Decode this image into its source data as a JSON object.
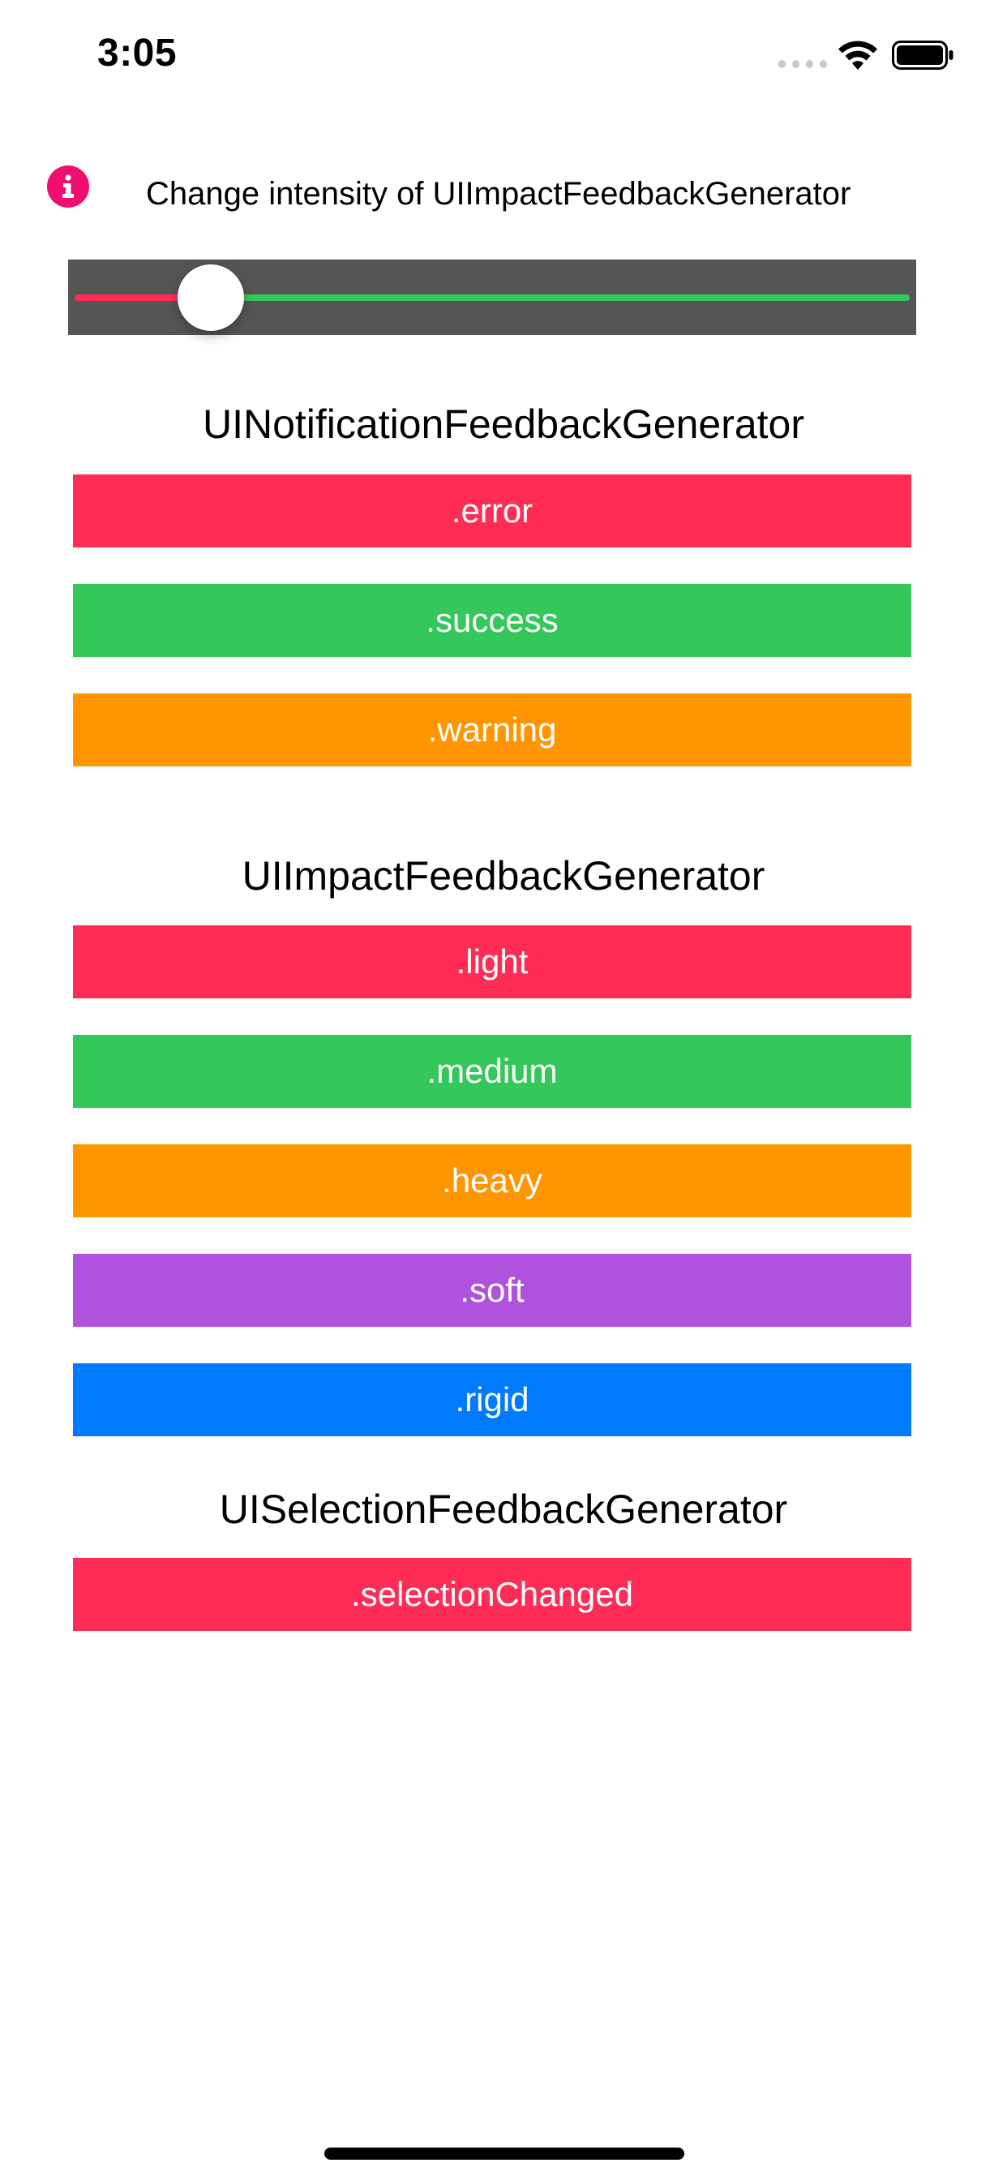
{
  "status_bar": {
    "time": "3:05",
    "signal_icon": "cellular-signal-dots-icon",
    "wifi_icon": "wifi-icon",
    "battery_icon": "battery-full-icon"
  },
  "intensity": {
    "info_icon": "info-icon",
    "label": "Change intensity of UIImpactFeedbackGenerator",
    "slider_value": 0.14
  },
  "sections": {
    "notification": {
      "title": "UINotificationFeedbackGenerator",
      "buttons": [
        {
          "label": ".error",
          "color": "#ff2d55"
        },
        {
          "label": ".success",
          "color": "#34c759"
        },
        {
          "label": ".warning",
          "color": "#ff9500"
        }
      ]
    },
    "impact": {
      "title": "UIImpactFeedbackGenerator",
      "buttons": [
        {
          "label": ".light",
          "color": "#ff2d55"
        },
        {
          "label": ".medium",
          "color": "#34c759"
        },
        {
          "label": ".heavy",
          "color": "#ff9500"
        },
        {
          "label": ".soft",
          "color": "#af52de"
        },
        {
          "label": ".rigid",
          "color": "#007aff"
        }
      ]
    },
    "selection": {
      "title": "UISelectionFeedbackGenerator",
      "buttons": [
        {
          "label": ".selectionChanged",
          "color": "#ff2d55"
        }
      ]
    }
  },
  "colors": {
    "accent_info": "#ee0f6f",
    "slider_background": "#555555",
    "slider_min_track": "#ff2d55",
    "slider_max_track": "#34c759"
  }
}
